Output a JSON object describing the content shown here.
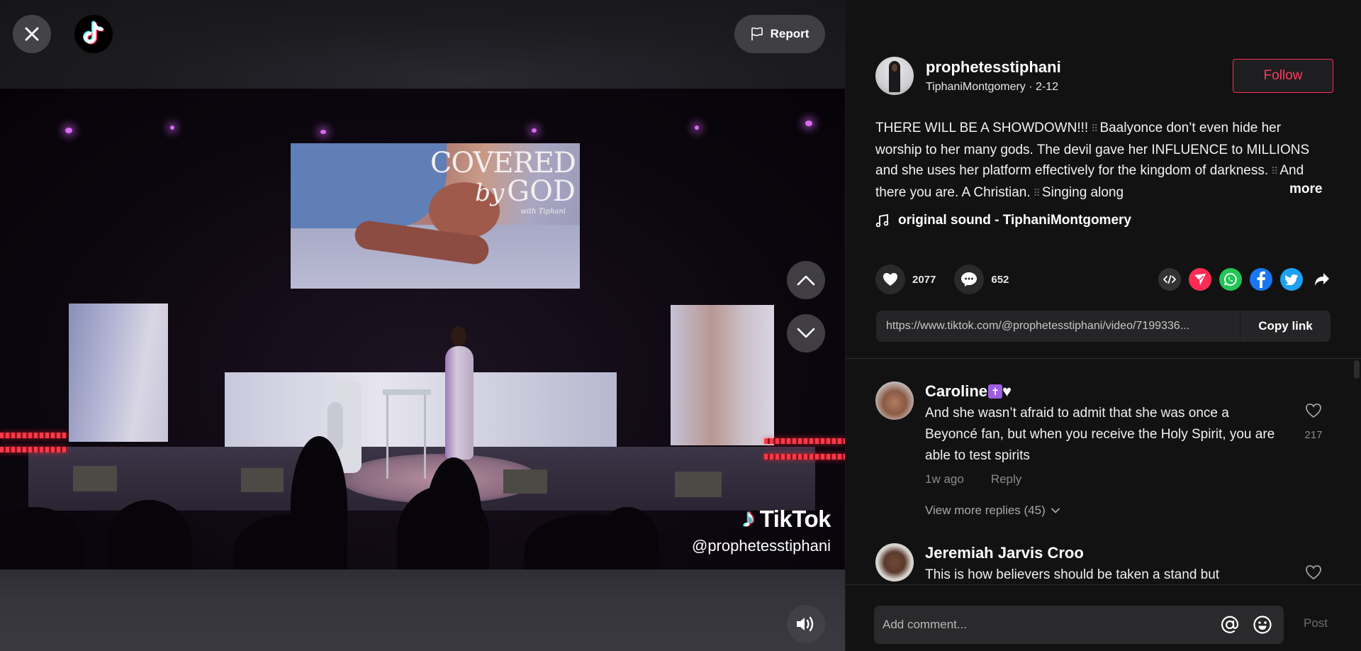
{
  "video": {
    "report_label": "Report",
    "screen_title_line1": "COVERED",
    "screen_title_by": "by",
    "screen_title_line2": "GOD",
    "screen_title_sub": "with Tiphani",
    "watermark_brand": "TikTok",
    "watermark_handle": "@prophetesstiphani"
  },
  "author": {
    "handle": "prophetesstiphani",
    "display_name": "TiphaniMontgomery",
    "separator": " · ",
    "date": "2-12",
    "follow_label": "Follow"
  },
  "caption": {
    "part1": "THERE WILL BE A SHOWDOWN!!!",
    "part2": "Baalyonce don’t even hide her worship to her many gods. The devil gave her INFLUENCE to MILLIONS and she uses her platform effectively for the kingdom of darkness.",
    "part3": "And there you are. A Christian.",
    "part4": "Singing along",
    "more_label": "more"
  },
  "sound": {
    "label": "original sound - TiphaniMontgomery"
  },
  "actions": {
    "likes": "2077",
    "comments": "652"
  },
  "share": {
    "icons": [
      "embed-icon",
      "send-to-friends-icon",
      "whatsapp-icon",
      "facebook-icon",
      "twitter-icon",
      "share-arrow-icon"
    ],
    "colors": {
      "embed": "#333335",
      "send": "#fe2c55",
      "whatsapp": "#25c456",
      "facebook": "#1877f2",
      "twitter": "#1da1f2"
    }
  },
  "link": {
    "url": "https://www.tiktok.com/@prophetesstiphani/video/7199336...",
    "copy_label": "Copy link"
  },
  "comments": [
    {
      "user": "Caroline",
      "user_suffix": "♥",
      "text": "And she wasn’t afraid to admit that she was once a Beyoncé fan, but when you receive the Holy Spirit, you are able to test spirits",
      "time": "1w ago",
      "reply_label": "Reply",
      "likes": "217",
      "view_replies": "View more replies (45)"
    },
    {
      "user": "Jeremiah Jarvis Croo",
      "text": "This is how believers should be taken a stand but"
    }
  ],
  "compose": {
    "placeholder": "Add comment...",
    "post_label": "Post"
  },
  "colors": {
    "brand_red": "#fe2c55",
    "brand_cyan": "#25f4ee",
    "panel_bg": "#121212"
  }
}
